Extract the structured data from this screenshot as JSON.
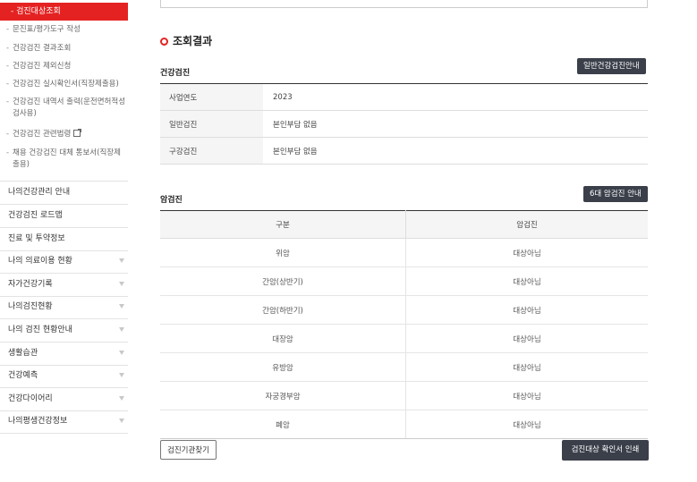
{
  "sidebar": {
    "active": "검진대상조회",
    "sub_items": [
      {
        "label": "문진표/평가도구 작성"
      },
      {
        "label": "건강검진 결과조회"
      },
      {
        "label": "건강검진 제외신청"
      },
      {
        "label": "건강검진 실시확인서(직장제출용)"
      },
      {
        "label": "건강검진 내역서 출력(운전면허적성검사용)"
      },
      {
        "label": "건강검진 관련법령",
        "external": true
      },
      {
        "label": "채용 건강검진 대체 통보서(직장제출용)"
      }
    ],
    "menu": [
      {
        "label": "나의건강관리 안내",
        "arrow": false
      },
      {
        "label": "건강검진 로드맵",
        "arrow": false
      },
      {
        "label": "진료 및 투약정보",
        "arrow": false
      },
      {
        "label": "나의 의료이용 현황",
        "arrow": true
      },
      {
        "label": "자가건강기록",
        "arrow": true
      },
      {
        "label": "나의검진현황",
        "arrow": true
      },
      {
        "label": "나의 검진 현황안내",
        "arrow": true
      },
      {
        "label": "생활습관",
        "arrow": true
      },
      {
        "label": "건강예측",
        "arrow": true
      },
      {
        "label": "건강다이어리",
        "arrow": true
      },
      {
        "label": "나의평생건강정보",
        "arrow": true
      }
    ]
  },
  "main": {
    "result_title": "조회결과",
    "health_check": {
      "title": "건강검진",
      "button": "일반건강검진안내",
      "rows": [
        {
          "label": "사업연도",
          "value": "2023"
        },
        {
          "label": "일반검진",
          "value": "본인부담 없음"
        },
        {
          "label": "구강검진",
          "value": "본인부담 없음"
        }
      ]
    },
    "cancer_check": {
      "title": "암검진",
      "button": "6대 암검진 안내",
      "headers": [
        "구분",
        "암검진"
      ],
      "rows": [
        [
          "위암",
          "대상아님"
        ],
        [
          "간암(상반기)",
          "대상아님"
        ],
        [
          "간암(하반기)",
          "대상아님"
        ],
        [
          "대장암",
          "대상아님"
        ],
        [
          "유방암",
          "대상아님"
        ],
        [
          "자궁경부암",
          "대상아님"
        ],
        [
          "폐암",
          "대상아님"
        ]
      ]
    },
    "find_button": "검진기관찾기",
    "print_button": "검진대상 확인서 인쇄"
  }
}
